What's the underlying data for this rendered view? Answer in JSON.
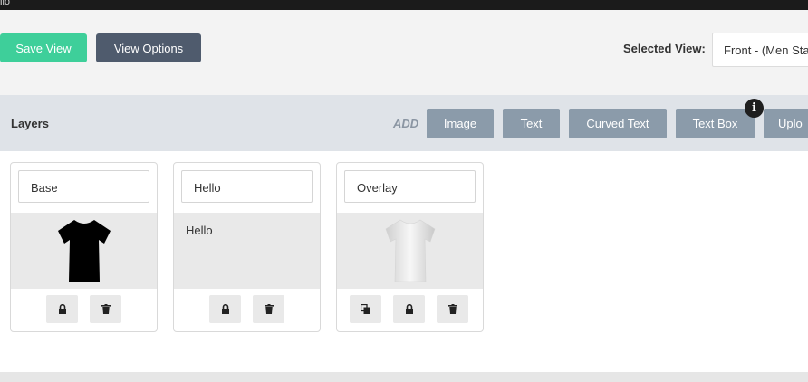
{
  "topbar": {
    "fragment": "ilo"
  },
  "toolbar": {
    "save_label": "Save View",
    "options_label": "View Options",
    "selected_view_label": "Selected View:",
    "selected_view_value": "Front - (Men Sta"
  },
  "layers": {
    "title": "Layers",
    "add_label": "ADD",
    "add_buttons": [
      "Image",
      "Text",
      "Curved Text",
      "Text Box",
      "Uplo"
    ],
    "info_icon": "i"
  },
  "cards": [
    {
      "name": "Base",
      "preview": "black-tshirt",
      "actions": [
        "lock-icon",
        "trash-icon"
      ]
    },
    {
      "name": "Hello",
      "preview_text": "Hello",
      "actions": [
        "lock-icon",
        "trash-icon"
      ]
    },
    {
      "name": "Overlay",
      "preview": "white-tshirt",
      "actions": [
        "copy-icon",
        "lock-icon",
        "trash-icon"
      ]
    }
  ],
  "colors": {
    "save": "#3ecf9a",
    "options": "#4f5b6d",
    "add_buttons": "#8b9baa",
    "layers_bar": "#dfe3e8"
  }
}
